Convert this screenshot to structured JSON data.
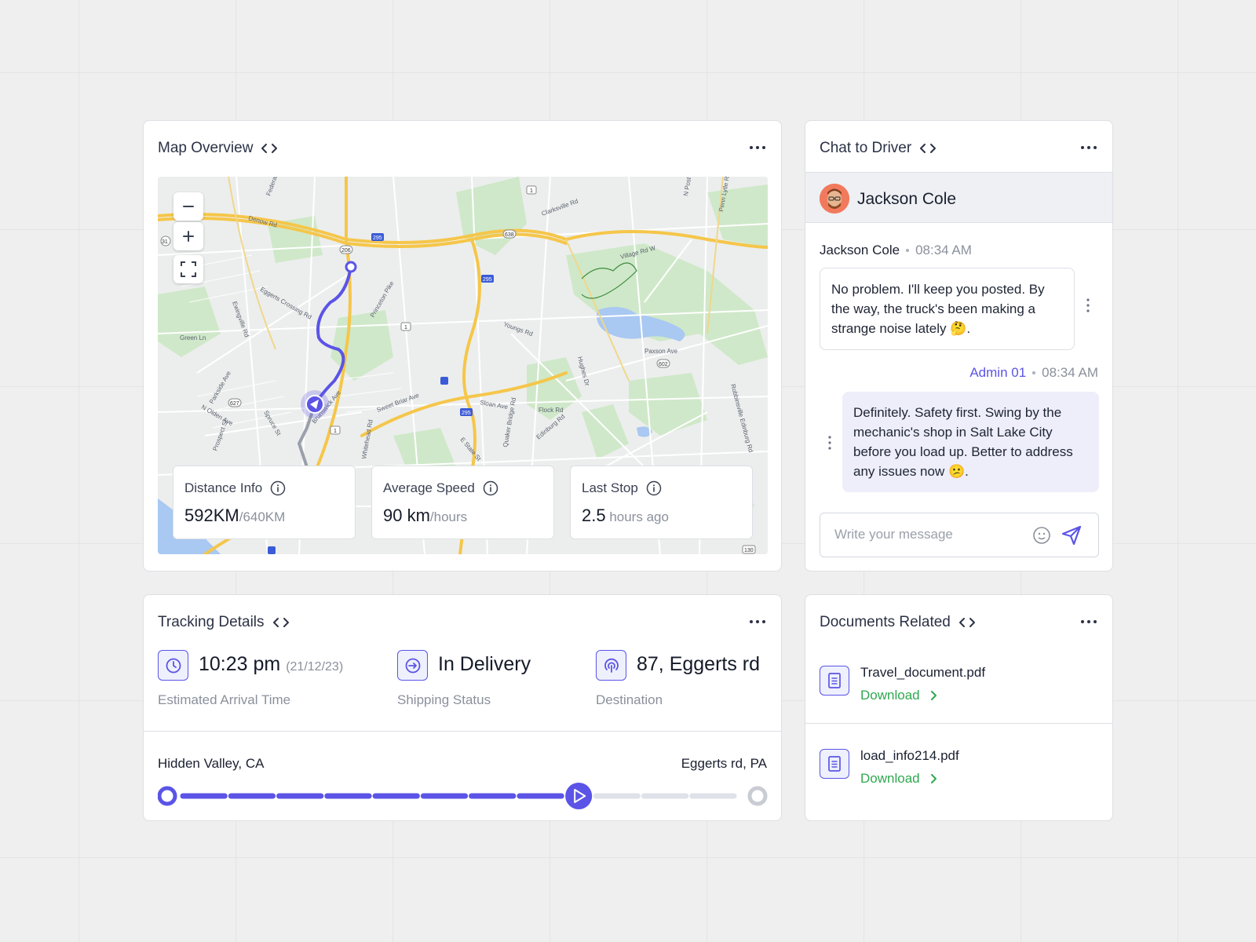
{
  "map_card": {
    "title": "Map Overview",
    "stats": [
      {
        "label": "Distance Info",
        "value": "592KM",
        "unit": "/640KM"
      },
      {
        "label": "Average Speed",
        "value": "90 km",
        "unit": "/hours"
      },
      {
        "label": "Last Stop",
        "value": "2.5",
        "unit": " hours ago"
      }
    ],
    "map_labels": [
      "Denow Rd",
      "Eggerts Crossing Rd",
      "Princeton Pike",
      "Clarksville Rd",
      "Village Rd W",
      "Youngs Rd",
      "Paxson Ave",
      "Sloan Ave",
      "Flock Rd",
      "Edinburg Rd",
      "Quaker Bridge Rd",
      "Brunswick Ave",
      "Sweet Briar Ave",
      "Spruce St",
      "Whitehead Rd",
      "Parkside Ave",
      "N Olden Ave",
      "Prospect St",
      "Green Ln",
      "Ewingville Rd",
      "Hughes Dr",
      "Robbinsville Edinburg Rd",
      "E State St",
      "Federal",
      "N Post",
      "Penn Lytle Rd",
      "295",
      "206",
      "638",
      "1",
      "602",
      "627",
      "31",
      "130"
    ]
  },
  "chat_card": {
    "title": "Chat to Driver",
    "driver_name": "Jackson Cole",
    "messages": [
      {
        "sender": "Jackson Cole",
        "time": "08:34 AM",
        "text": "No problem. I'll keep you posted. By the way, the truck's been making a strange noise lately 🤔."
      },
      {
        "sender": "Admin 01",
        "time": "08:34 AM",
        "text": "Definitely. Safety first. Swing by the mechanic's shop in Salt Lake City before you load up. Better to address any issues now 😕."
      }
    ],
    "input_placeholder": "Write your message"
  },
  "tracking_card": {
    "title": "Tracking Details",
    "eta": {
      "value": "10:23 pm",
      "date": "(21/12/23)",
      "label": "Estimated Arrival Time"
    },
    "status": {
      "value": "In Delivery",
      "label": "Shipping Status"
    },
    "destination": {
      "value": "87, Eggerts rd",
      "label": "Destination"
    },
    "route": {
      "from": "Hidden Valley, CA",
      "to": "Eggerts rd, PA",
      "segments_total": 11,
      "segments_done": 8
    }
  },
  "docs_card": {
    "title": "Documents Related",
    "documents": [
      {
        "name": "Travel_document.pdf",
        "action": "Download"
      },
      {
        "name": "load_info214.pdf",
        "action": "Download"
      }
    ]
  },
  "colors": {
    "accent": "#5b54e6",
    "download": "#2fa84f",
    "admin_bubble": "#eeeefb",
    "map_green": "#cfe8c9",
    "map_water": "#a9c8f2",
    "road_yellow": "#f5c64a"
  },
  "icons": {
    "code": "code-brackets-icon",
    "more": "more-horizontal-icon",
    "info": "info-circle-icon",
    "clock": "clock-icon",
    "shipping": "arrow-circle-icon",
    "destination": "broadcast-icon",
    "document": "document-icon",
    "send": "send-icon",
    "emoji": "emoji-icon"
  }
}
